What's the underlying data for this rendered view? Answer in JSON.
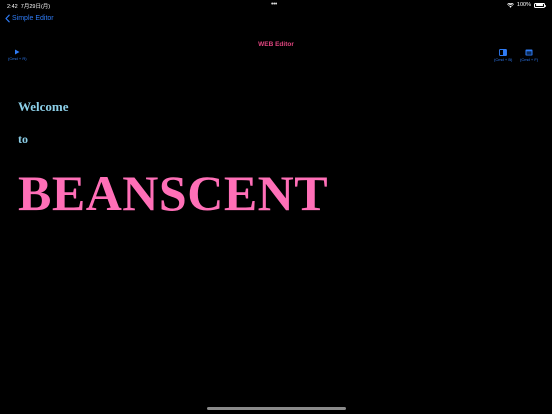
{
  "status_bar": {
    "time": "2:42",
    "date": "7月29日(月)",
    "battery": "100%",
    "battery_level": 1.0
  },
  "nav": {
    "back_label": "Simple Editor",
    "title": "WEB Editor"
  },
  "toolbar": {
    "run_shortcut": "(Cmd + R)",
    "btn_a_shortcut": "(Cmd + B)",
    "btn_b_shortcut": "(Cmd + F)"
  },
  "content": {
    "line1": "Welcome",
    "line2": "to",
    "headline": "BEANSCENT"
  },
  "colors": {
    "background": "#000000",
    "accent_blue": "#2f7cf6",
    "title_pink": "#e0457f",
    "text_light_blue": "#8ccfe8",
    "headline_pink": "#ff6fb7"
  },
  "icons": {
    "back": "chevron-left-icon",
    "run": "play-icon",
    "btn_a": "split-view-icon",
    "btn_b": "window-icon"
  }
}
